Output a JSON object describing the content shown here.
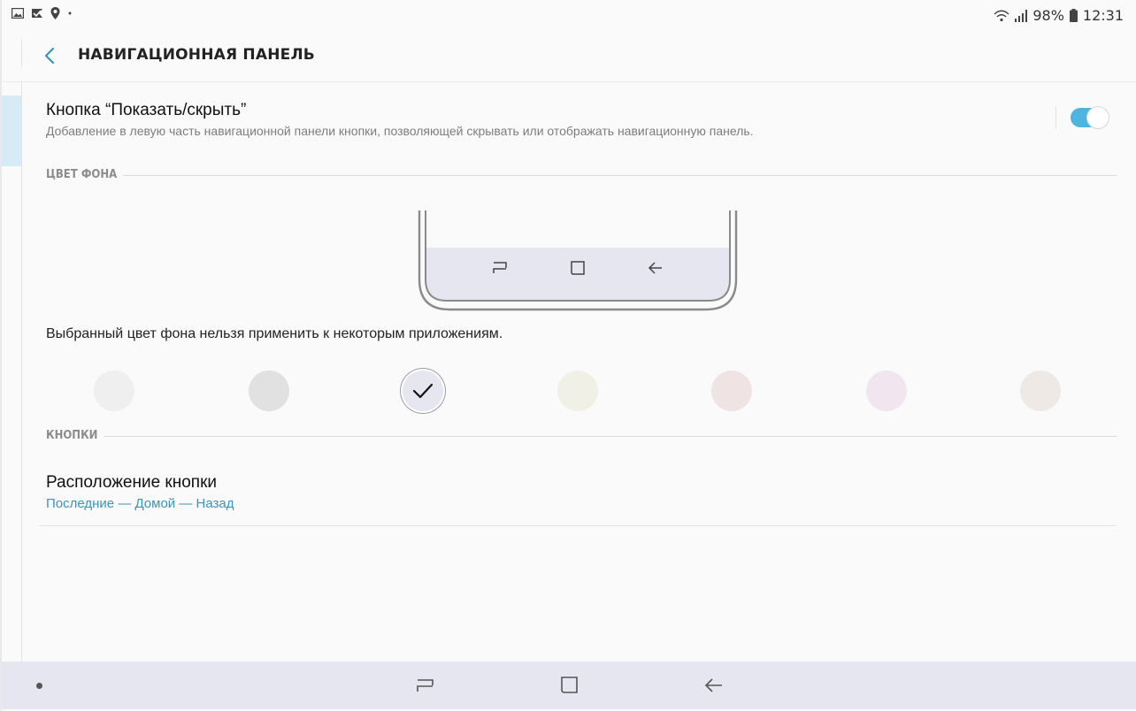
{
  "statusbar": {
    "battery": "98%",
    "time": "12:31",
    "left_icons": [
      "image-icon",
      "checkmark-flag-icon",
      "location-icon",
      "dot-icon"
    ],
    "right_icons": [
      "wifi-icon",
      "signal-icon",
      "battery-icon"
    ]
  },
  "header": {
    "title": "НАВИГАЦИОННАЯ ПАНЕЛЬ",
    "back_icon": "chevron-left-icon"
  },
  "show_hide": {
    "title": "Кнопка “Показать/скрыть”",
    "subtitle": "Добавление в левую часть навигационной панели кнопки, позволяющей скрывать или отображать навигационную панель.",
    "enabled": true,
    "accent_color": "#50b4e0"
  },
  "background_section": {
    "label": "ЦВЕТ ФОНА",
    "note": "Выбранный цвет фона нельзя применить к некоторым приложениям.",
    "swatches": [
      {
        "color": "#efefef",
        "selected": false
      },
      {
        "color": "#e1e1e1",
        "selected": false
      },
      {
        "color": "#e6e6f0",
        "selected": true
      },
      {
        "color": "#f1f0e6",
        "selected": false
      },
      {
        "color": "#efe4e3",
        "selected": false
      },
      {
        "color": "#f1e5ef",
        "selected": false
      },
      {
        "color": "#efe9e6",
        "selected": false
      }
    ]
  },
  "buttons_section": {
    "label": "КНОПКИ",
    "position_title": "Расположение кнопки",
    "position_value": "Последние — Домой — Назад"
  },
  "navbar": {
    "background": "#e6e6f0",
    "icons": [
      "dot-icon",
      "recents-icon",
      "home-icon",
      "back-icon"
    ]
  }
}
